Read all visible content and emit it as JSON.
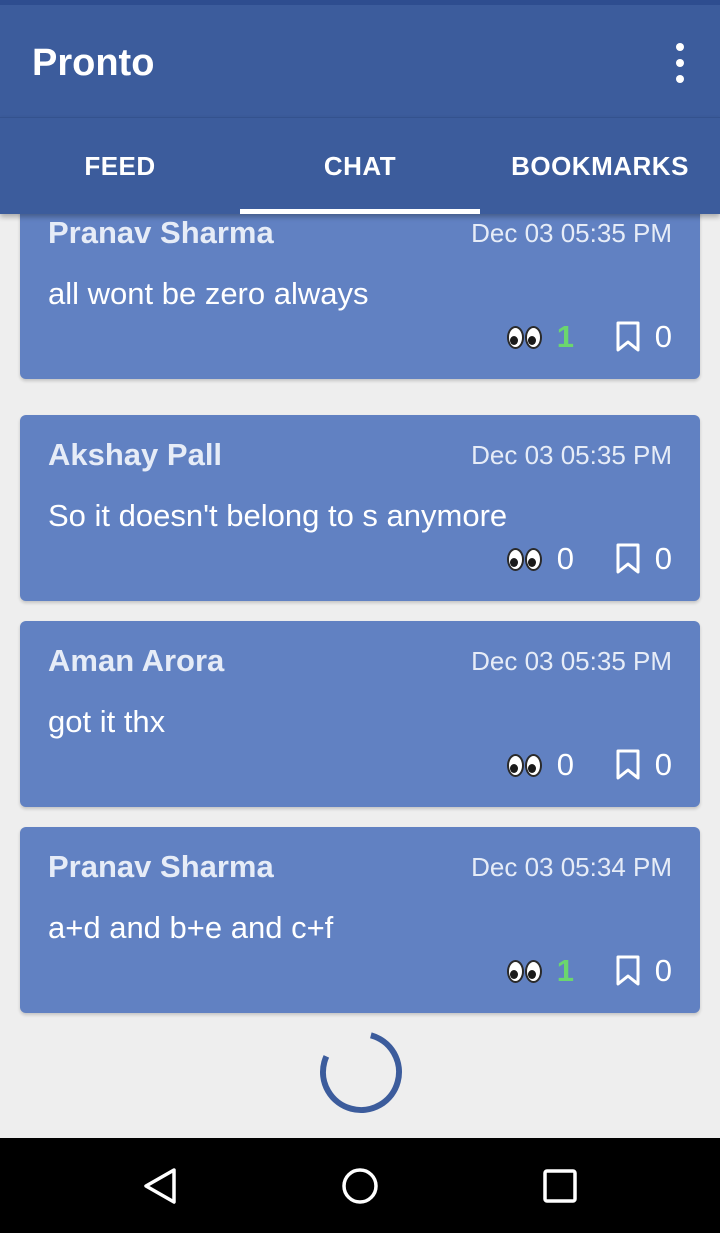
{
  "app": {
    "title": "Pronto"
  },
  "tabs": [
    {
      "label": "FEED",
      "active": false
    },
    {
      "label": "CHAT",
      "active": true
    },
    {
      "label": "BOOKMARKS",
      "active": false
    }
  ],
  "messages": [
    {
      "sender": "Pranav Sharma",
      "time": "Dec 03 05:35 PM",
      "text": "all wont be zero always",
      "seen": "1",
      "bookmarks": "0"
    },
    {
      "sender": "Akshay Pall",
      "time": "Dec 03 05:35 PM",
      "text": "So it doesn't belong to s anymore",
      "seen": "0",
      "bookmarks": "0"
    },
    {
      "sender": "Aman Arora",
      "time": "Dec 03 05:35 PM",
      "text": "got it thx",
      "seen": "0",
      "bookmarks": "0"
    },
    {
      "sender": "Pranav Sharma",
      "time": "Dec 03 05:34 PM",
      "text": "a+d and b+e and c+f",
      "seen": "1",
      "bookmarks": "0"
    }
  ],
  "icons": {
    "menu": "more-vert-icon",
    "seen": "eyes-icon",
    "bookmark": "bookmark-icon",
    "loading": "loading-spinner",
    "nav": [
      "back-icon",
      "home-icon",
      "recents-icon"
    ]
  },
  "colors": {
    "app_bar": "#3c5c9c",
    "card": "#6181c2",
    "background": "#eeeeee",
    "seen_highlight": "#6bd66e",
    "spinner": "#3c5c9c"
  }
}
